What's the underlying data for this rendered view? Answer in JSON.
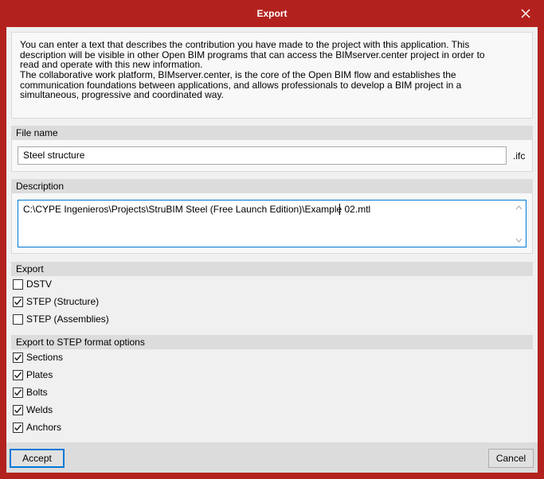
{
  "window": {
    "title": "Export"
  },
  "info": {
    "lines": [
      "You can enter a text that describes the contribution you have made to the project with this application. This",
      "description will be visible in other Open BIM programs that can access the BIMserver.center project in order to",
      "read and operate with this new information.",
      "The collaborative work platform, BIMserver.center, is the core of the Open BIM flow and establishes the",
      "communication foundations between applications, and allows professionals to develop a BIM project in a",
      "simultaneous, progressive and coordinated way."
    ]
  },
  "file_name": {
    "header": "File name",
    "value": "Steel structure",
    "extension": ".ifc"
  },
  "description": {
    "header": "Description",
    "value": "C:\\CYPE Ingenieros\\Projects\\StruBIM Steel (Free Launch Edition)\\Example 02.mtl"
  },
  "export": {
    "header": "Export",
    "options": [
      {
        "label": "DSTV",
        "checked": false
      },
      {
        "label": "STEP (Structure)",
        "checked": true
      },
      {
        "label": "STEP (Assemblies)",
        "checked": false
      }
    ]
  },
  "step_options": {
    "header": "Export to STEP format options",
    "options": [
      {
        "label": "Sections",
        "checked": true
      },
      {
        "label": "Plates",
        "checked": true
      },
      {
        "label": "Bolts",
        "checked": true
      },
      {
        "label": "Welds",
        "checked": true
      },
      {
        "label": "Anchors",
        "checked": true
      }
    ]
  },
  "buttons": {
    "accept": "Accept",
    "cancel": "Cancel"
  },
  "colors": {
    "titlebar": "#b3211e",
    "accent": "#0078d7"
  },
  "icons": {
    "close": "close-icon",
    "check": "checkmark-icon",
    "scroll_up": "scroll-up-arrow-icon",
    "scroll_down": "scroll-down-arrow-icon"
  }
}
